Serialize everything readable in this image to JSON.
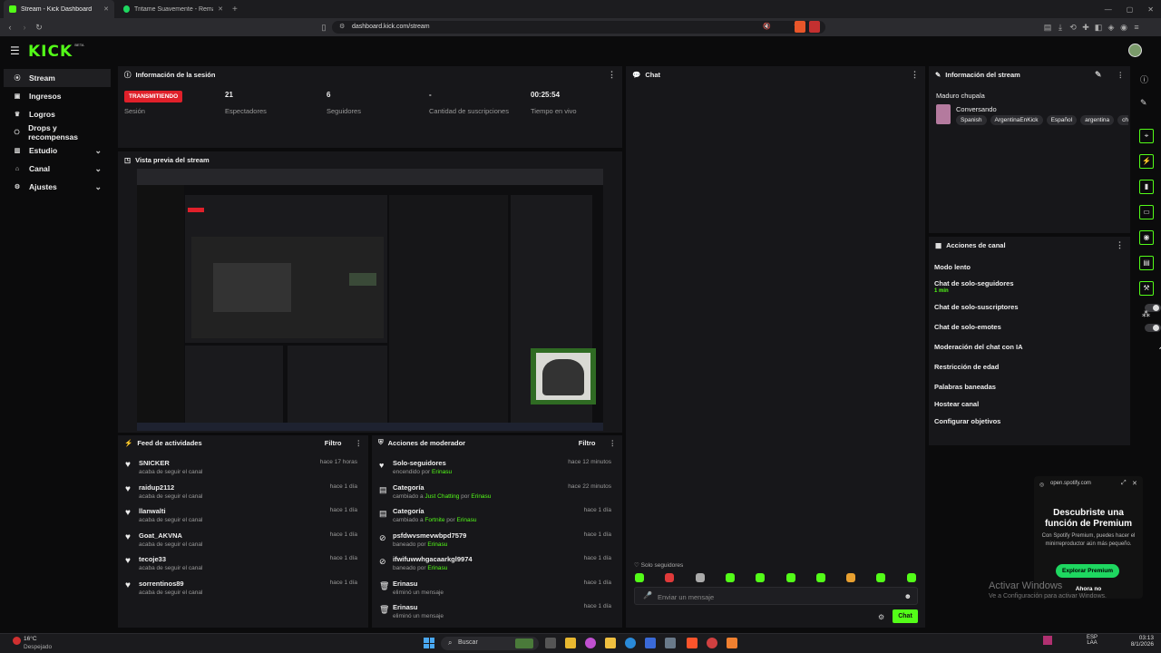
{
  "browser": {
    "tabs": [
      {
        "label": "Stream - Kick Dashboard",
        "active": true
      },
      {
        "label": "Tritame Suavemente - Remaste",
        "active": false
      }
    ],
    "new_tab": "+",
    "url": "dashboard.kick.com/stream"
  },
  "kick": {
    "logo": "KICK",
    "beta": "BETA"
  },
  "sidebar": {
    "items": [
      {
        "label": "Stream",
        "icon": "broadcast-icon",
        "active": true
      },
      {
        "label": "Ingresos",
        "icon": "money-icon"
      },
      {
        "label": "Logros",
        "icon": "trophy-icon"
      },
      {
        "label": "Drops y recompensas",
        "icon": "gift-icon"
      },
      {
        "label": "Estudio",
        "icon": "studio-icon",
        "chevron": true
      },
      {
        "label": "Canal",
        "icon": "channel-icon",
        "chevron": true
      },
      {
        "label": "Ajustes",
        "icon": "gear-icon",
        "chevron": true
      }
    ]
  },
  "session": {
    "title": "Información de la sesión",
    "status": "TRANSMITIENDO",
    "status_label": "Sesión",
    "viewers": "21",
    "viewers_label": "Espectadores",
    "followers": "6",
    "followers_label": "Seguidores",
    "subs": "-",
    "subs_label": "Cantidad de suscripciones",
    "live_time": "00:25:54",
    "live_time_label": "Tiempo en vivo"
  },
  "preview": {
    "title": "Vista previa del stream"
  },
  "chat": {
    "title": "Chat",
    "followers_only": "Solo seguidores",
    "placeholder": "Enviar un mensaje",
    "send": "Chat"
  },
  "stream_info": {
    "title": "Información del stream",
    "stream_title": "Maduro chupala",
    "category": "Conversando",
    "tags": [
      "Spanish",
      "ArgentinaEnKick",
      "Español",
      "argentina",
      "chill"
    ]
  },
  "channel_actions": {
    "title": "Acciones de canal",
    "items": [
      {
        "label": "Modo lento",
        "control": "chevron"
      },
      {
        "label": "Chat de solo-seguidores",
        "sub": "1 min",
        "control": "chevron"
      },
      {
        "label": "Chat de solo-suscriptores",
        "control": "toggle"
      },
      {
        "label": "Chat de solo-emotes",
        "control": "toggle"
      },
      {
        "label": "Moderación del chat con IA",
        "control": "external"
      },
      {
        "label": "Restricción de edad",
        "control": "chevron"
      },
      {
        "label": "Palabras baneadas",
        "control": "chevron"
      },
      {
        "label": "Hostear canal",
        "control": "none"
      },
      {
        "label": "Configurar objetivos",
        "control": "chevron"
      }
    ]
  },
  "feed": {
    "title": "Feed de actividades",
    "filter": "Filtro",
    "items": [
      {
        "name": "SNICKER",
        "desc": "acaba de seguir el canal",
        "time": "hace 17 horas"
      },
      {
        "name": "raidup2112",
        "desc": "acaba de seguir el canal",
        "time": "hace 1 día"
      },
      {
        "name": "llanwalti",
        "desc": "acaba de seguir el canal",
        "time": "hace 1 día"
      },
      {
        "name": "Goat_AKVNA",
        "desc": "acaba de seguir el canal",
        "time": "hace 1 día"
      },
      {
        "name": "tecoje33",
        "desc": "acaba de seguir el canal",
        "time": "hace 1 día"
      },
      {
        "name": "sorrentinos89",
        "desc": "acaba de seguir el canal",
        "time": "hace 1 día"
      }
    ]
  },
  "mod": {
    "title": "Acciones de moderador",
    "filter": "Filtro",
    "items": [
      {
        "name": "Solo-seguidores",
        "d1": "encendido por ",
        "d2": "",
        "d3": "",
        "user": "Erinasu",
        "time": "hace 12 minutos",
        "icon": "heart-icon"
      },
      {
        "name": "Categoría",
        "d1": "cambiado a ",
        "d2": "Just Chatting",
        "d3": " por ",
        "user": "Erinasu",
        "time": "hace 22 minutos",
        "icon": "category-icon"
      },
      {
        "name": "Categoría",
        "d1": "cambiado a ",
        "d2": "Fortnite",
        "d3": " por ",
        "user": "Erinasu",
        "time": "hace 1 día",
        "icon": "category-icon"
      },
      {
        "name": "psfdwvsmevwbpd7579",
        "d1": "baneado por ",
        "d2": "",
        "d3": "",
        "user": "Erinasu",
        "time": "hace 1 día",
        "icon": "ban-icon"
      },
      {
        "name": "ifwifuwwhgacaarkgl9974",
        "d1": "baneado por ",
        "d2": "",
        "d3": "",
        "user": "Erinasu",
        "time": "hace 1 día",
        "icon": "ban-icon"
      },
      {
        "name": "Erinasu",
        "d1": "eliminó un mensaje",
        "d2": "",
        "d3": "",
        "user": "",
        "time": "hace 1 día",
        "icon": "trash-icon"
      },
      {
        "name": "Erinasu",
        "d1": "eliminó un mensaje",
        "d2": "",
        "d3": "",
        "user": "",
        "time": "hace 1 día",
        "icon": "trash-icon"
      }
    ]
  },
  "spotify": {
    "domain": "open.spotify.com",
    "heading": "Descubriste una función de Premium",
    "body": "Con Spotify Premium, puedes hacer el minirreproductor aún más pequeño.",
    "cta": "Explorar Premium",
    "later": "Ahora no"
  },
  "watermark": {
    "line1": "Activar Windows",
    "line2": "Ve a Configuración para activar Windows."
  },
  "taskbar": {
    "temp": "16°C",
    "weather": "Despejado",
    "search": "Buscar",
    "lang1": "ESP",
    "lang2": "LAA",
    "time": "03:13",
    "date": "8/1/2026"
  },
  "colors": {
    "accent": "#53fc18",
    "live": "#e0202a",
    "spotify": "#1ed760"
  }
}
